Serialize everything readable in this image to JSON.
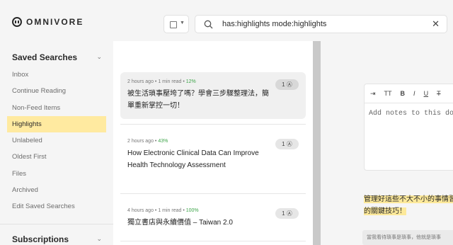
{
  "app": {
    "name": "OMNIVORE"
  },
  "sidebar": {
    "saved_searches_title": "Saved Searches",
    "items": [
      {
        "label": "Inbox",
        "active": false
      },
      {
        "label": "Continue Reading",
        "active": false
      },
      {
        "label": "Non-Feed Items",
        "active": false
      },
      {
        "label": "Highlights",
        "active": true
      },
      {
        "label": "Unlabeled",
        "active": false
      },
      {
        "label": "Oldest First",
        "active": false
      },
      {
        "label": "Files",
        "active": false
      },
      {
        "label": "Archived",
        "active": false
      },
      {
        "label": "Edit Saved Searches",
        "active": false
      }
    ],
    "subscriptions_title": "Subscriptions"
  },
  "search": {
    "query": "has:highlights mode:highlights"
  },
  "items": [
    {
      "meta": "2 hours ago • 1 min read • ",
      "percent": "12%",
      "title": "被生活瑣事壓垮了嗎？學會三步驟整理法，簡單重新掌控一切！",
      "highlights": "1"
    },
    {
      "meta": "2 hours ago • ",
      "percent": "43%",
      "title": "How Electronic Clinical Data Can Improve Health Technology Assessment",
      "highlights": "1"
    },
    {
      "meta": "4 hours ago • 1 min read • ",
      "percent": "100%",
      "title": "獨立書店與永續價值 – Taiwan 2.0",
      "highlights": "1"
    }
  ],
  "notes": {
    "placeholder": "Add notes to this do",
    "highlight_text": "管理好這些不大不小的事情習的關鍵技巧！",
    "quote_text": "當我看待瑣事是瑣事，他就是瑣事"
  },
  "colors": {
    "active_nav": "#ffeaa0",
    "percent_green": "#3ea54a",
    "highlight": "#fde99a"
  }
}
